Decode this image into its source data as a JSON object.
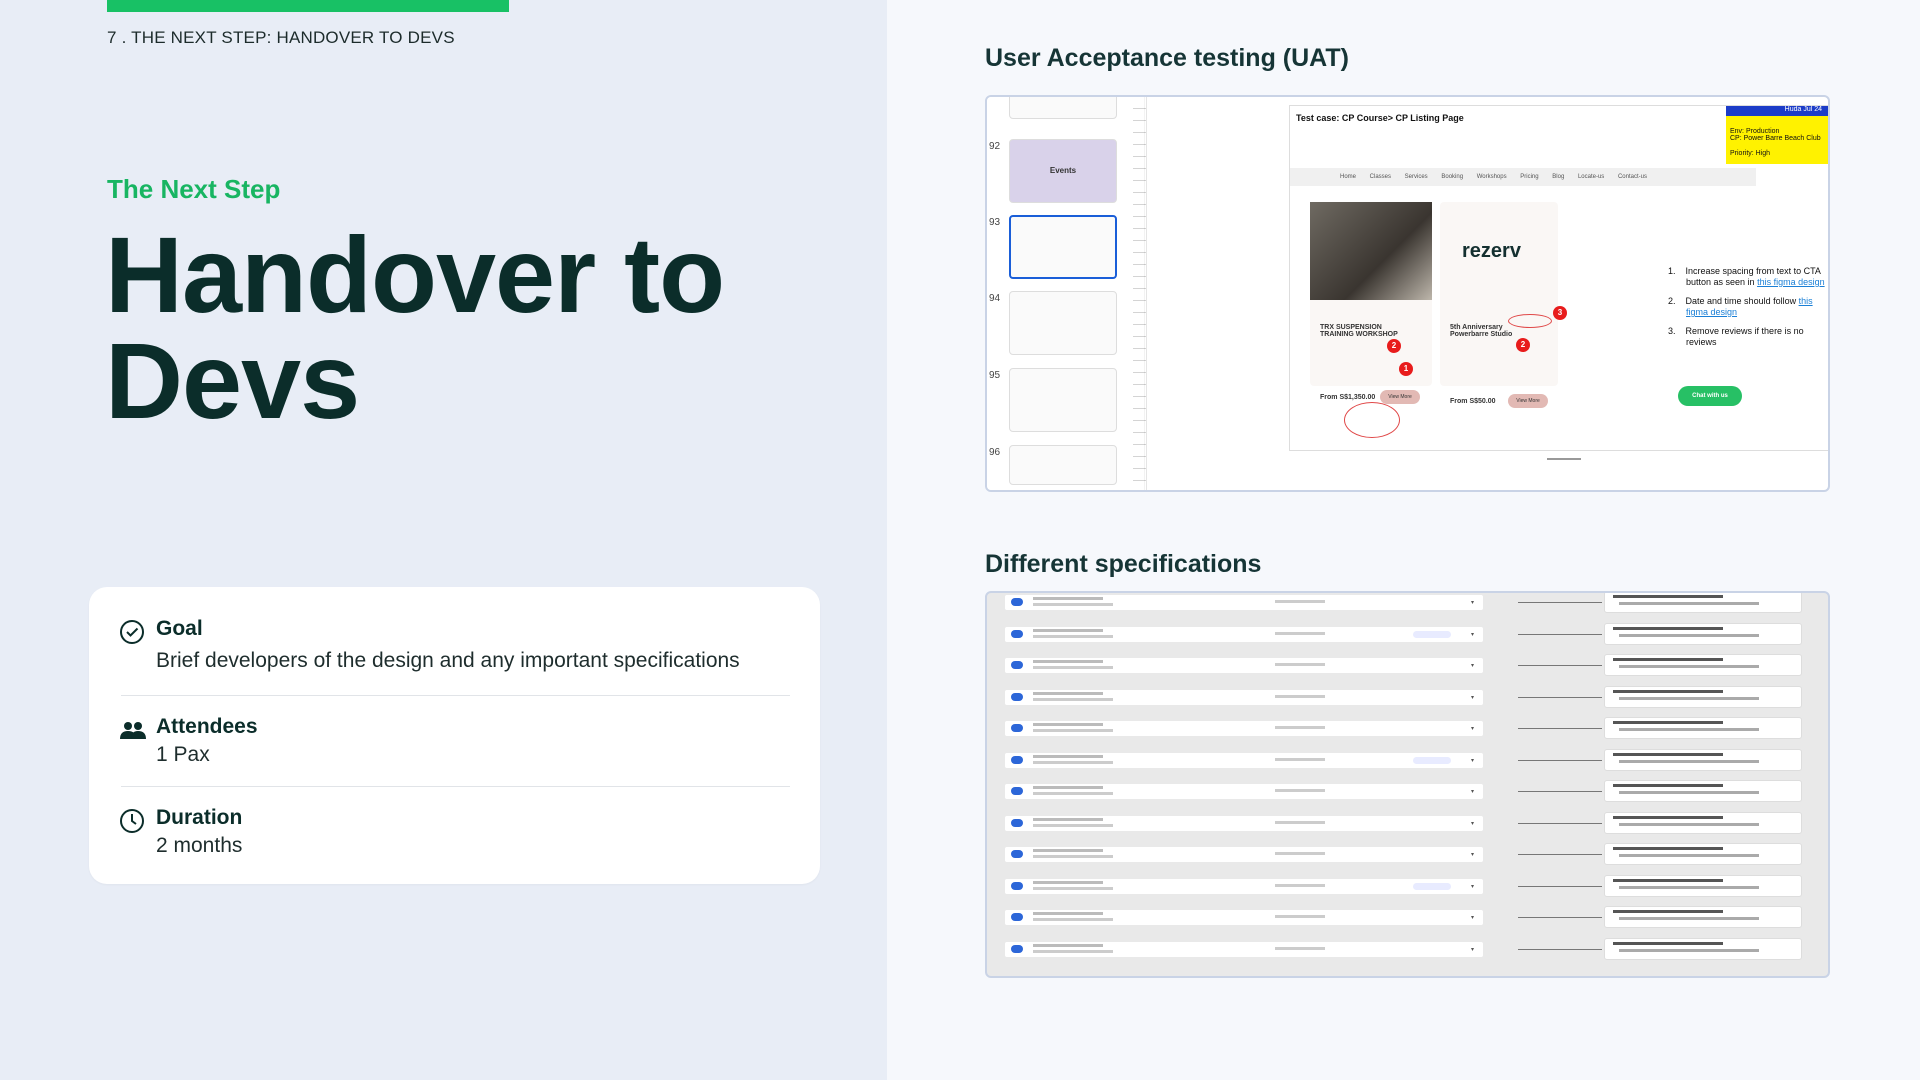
{
  "header": {
    "section_number": "7 .",
    "section_title": "THE NEXT STEP: HANDOVER TO DEVS"
  },
  "hero": {
    "kicker": "The Next Step",
    "title_line1": "Handover to",
    "title_line2": "Devs"
  },
  "info_card": {
    "goal": {
      "label": "Goal",
      "value": "Brief developers of the design and any important specifications",
      "icon": "check-circle-icon"
    },
    "attendees": {
      "label": "Attendees",
      "value": "1 Pax",
      "icon": "people-icon"
    },
    "duration": {
      "label": "Duration",
      "value": "2 months",
      "icon": "clock-icon"
    }
  },
  "uat": {
    "heading": "User Acceptance testing (UAT)",
    "slide_numbers": [
      "92",
      "93",
      "94",
      "95",
      "96"
    ],
    "events_thumb": "Events",
    "test_case": "Test case: CP Course> CP Listing Page",
    "note": {
      "head": "Huda  Jul 24",
      "env": "Env: Production",
      "cp": "CP: Power Barre Beach Club",
      "priority": "Priority: High"
    },
    "nav_items": "Home Classes Services Booking Workshops Pricing Blog Locate-us Contact-us",
    "brand": "rezerv",
    "card1_title": "TRX SUSPENSION TRAINING WORKSHOP",
    "card1_price": "From S$1,350.00",
    "card2_title": "5th Anniversary Powerbarre Studio",
    "card2_price": "From S$50.00",
    "view_more": "View More",
    "instructions": [
      {
        "num": "1.",
        "text": "Increase spacing from text to CTA button as seen in ",
        "link": "this figma design"
      },
      {
        "num": "2.",
        "text": "Date and time should follow ",
        "link": "this figma design"
      },
      {
        "num": "3.",
        "text": "Remove reviews if there is no reviews",
        "link": ""
      }
    ],
    "chat_button": "Chat with us",
    "badges": [
      "2",
      "1",
      "2",
      "3"
    ]
  },
  "specs": {
    "heading": "Different specifications",
    "row_count": 12
  }
}
